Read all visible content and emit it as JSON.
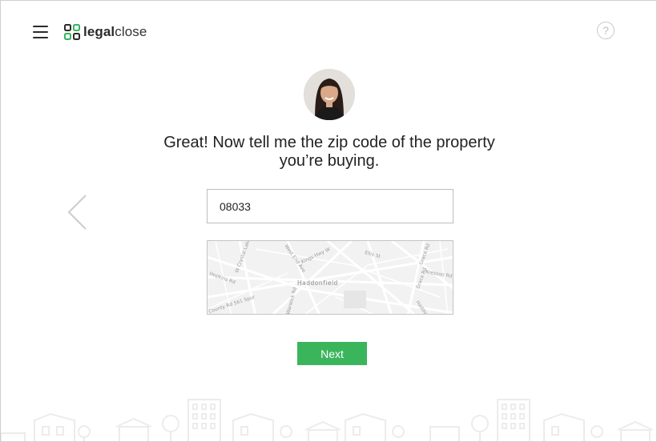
{
  "header": {
    "logo": {
      "bold_text": "legal",
      "regular_text": "close",
      "icon": "logo-squares-icon",
      "accent_color": "#3bb55c"
    },
    "menu_icon": "hamburger-icon",
    "help_icon": "question-circle-icon",
    "help_glyph": "?"
  },
  "main": {
    "prompt": "Great! Now tell me the zip code of the property you’re buying.",
    "zip_input": {
      "value": "08033",
      "placeholder": ""
    },
    "map": {
      "center_label": "Haddonfield",
      "street_labels": [
        "W Crystal Lake A",
        "West End Ave",
        "Kings Hwy W",
        "Ellis St",
        "Grace Rd",
        "Kresson Rd",
        "Grace Rd",
        "Haddon",
        "Hopkins Rd",
        "County Rd 561 Spur",
        "Warwick Rd"
      ]
    },
    "next_button": {
      "label": "Next",
      "color": "#3bb55c"
    },
    "prev_arrow_icon": "chevron-left-icon"
  }
}
